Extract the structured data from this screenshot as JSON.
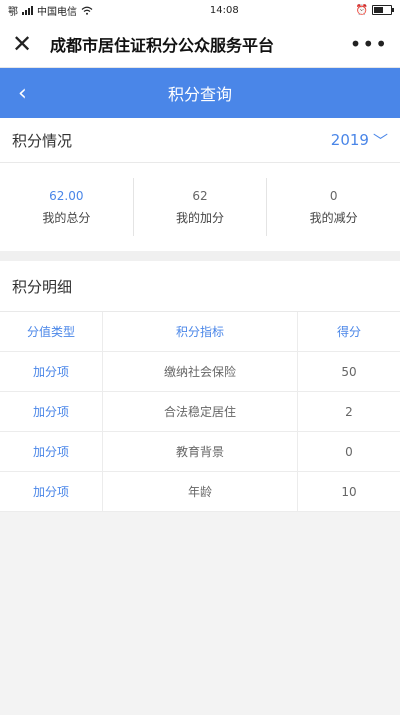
{
  "status": {
    "carrier": "中国电信",
    "time": "14:08",
    "left_glyph": "鄂"
  },
  "wechat": {
    "title": "成都市居住证积分公众服务平台",
    "close": "✕",
    "more": "•••"
  },
  "appbar": {
    "title": "积分查询",
    "back": "‹"
  },
  "overview": {
    "title": "积分情况",
    "year": "2019",
    "year_chevron": "﹀",
    "total": {
      "value": "62.00",
      "label": "我的总分"
    },
    "add": {
      "value": "62",
      "label": "我的加分"
    },
    "minus": {
      "value": "0",
      "label": "我的减分"
    }
  },
  "detail": {
    "title": "积分明细",
    "headers": [
      "分值类型",
      "积分指标",
      "得分"
    ],
    "rows": [
      [
        "加分项",
        "缴纳社会保险",
        "50"
      ],
      [
        "加分项",
        "合法稳定居住",
        "2"
      ],
      [
        "加分项",
        "教育背景",
        "0"
      ],
      [
        "加分项",
        "年龄",
        "10"
      ]
    ]
  },
  "colors": {
    "accent": "#4a86e8"
  },
  "icons": {
    "close": "close-icon",
    "back": "back-arrow-icon",
    "more": "more-icon",
    "year": "chevron-down-icon"
  }
}
